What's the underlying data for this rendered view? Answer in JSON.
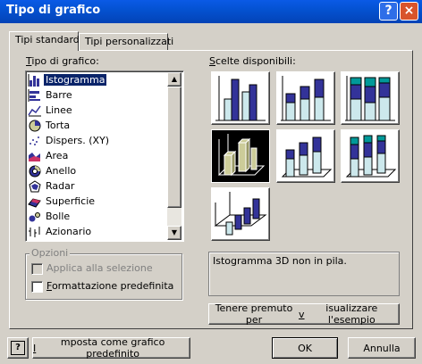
{
  "window": {
    "title": "Tipo di grafico",
    "help_glyph": "?",
    "close_glyph": "×"
  },
  "tabs": [
    {
      "label": "Tipi standard",
      "active": true
    },
    {
      "label": "Tipi personalizzati",
      "active": false
    }
  ],
  "chart_type_label": {
    "mnemonic": "T",
    "rest": "ipo di grafico:"
  },
  "chart_types": [
    {
      "label": "Istogramma",
      "icon": "column-chart-icon",
      "selected": true
    },
    {
      "label": "Barre",
      "icon": "bar-chart-icon"
    },
    {
      "label": "Linee",
      "icon": "line-chart-icon"
    },
    {
      "label": "Torta",
      "icon": "pie-chart-icon"
    },
    {
      "label": "Dispers. (XY)",
      "icon": "scatter-chart-icon"
    },
    {
      "label": "Area",
      "icon": "area-chart-icon"
    },
    {
      "label": "Anello",
      "icon": "doughnut-chart-icon"
    },
    {
      "label": "Radar",
      "icon": "radar-chart-icon"
    },
    {
      "label": "Superficie",
      "icon": "surface-chart-icon"
    },
    {
      "label": "Bolle",
      "icon": "bubble-chart-icon"
    },
    {
      "label": "Azionario",
      "icon": "stock-chart-icon"
    }
  ],
  "options": {
    "legend": "Opzioni",
    "apply_to_selection": {
      "label": "Applica alla selezione",
      "checked": false,
      "enabled": false
    },
    "default_formatting": {
      "mnemonic": "F",
      "rest": "ormattazione predefinita",
      "checked": false,
      "enabled": true
    }
  },
  "subtypes_label": {
    "mnemonic": "S",
    "rest": "celte disponibili:"
  },
  "subtypes": [
    {
      "name": "clustered-column",
      "selected": false
    },
    {
      "name": "stacked-column",
      "selected": false
    },
    {
      "name": "100-stacked-column",
      "selected": false
    },
    {
      "name": "3d-clustered-column",
      "selected": true
    },
    {
      "name": "3d-stacked-column",
      "selected": false
    },
    {
      "name": "3d-100-stacked-column",
      "selected": false
    },
    {
      "name": "3d-column",
      "selected": false
    }
  ],
  "description": "Istogramma 3D non in pila.",
  "preview_button": {
    "pre": "Tenere premuto per ",
    "mnemonic": "v",
    "post": "isualizzare l'esempio"
  },
  "set_default_button": {
    "mnemonic": "I",
    "rest": "mposta come grafico predefinito"
  },
  "ok_label": "OK",
  "cancel_label": "Annulla",
  "colors": {
    "titlebar": "#0452d2",
    "selection": "#0a246a",
    "bar_blue": "#333399",
    "bar_light": "#cce8ec",
    "bar_teal": "#009999",
    "bar_olive": "#cccc99"
  }
}
